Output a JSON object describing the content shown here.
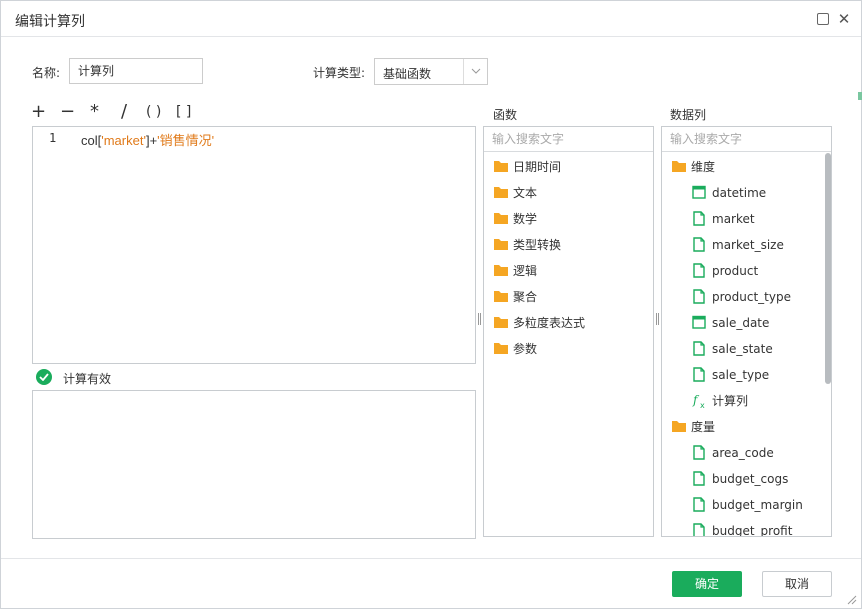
{
  "dialog": {
    "title": "编辑计算列"
  },
  "form": {
    "name_label": "名称:",
    "name_value": "计算列",
    "type_label": "计算类型:",
    "type_value": "基础函数"
  },
  "operators": [
    "+",
    "−",
    "*",
    "/",
    "( )",
    "[ ]"
  ],
  "editor": {
    "line_number": "1",
    "code": {
      "fn": "col",
      "open": "[",
      "arg": "'market'",
      "close": "]",
      "plus": "+",
      "literal": "'销售情况'"
    }
  },
  "validation": {
    "text": "计算有效",
    "color": "#1aac5c"
  },
  "functions_panel": {
    "title": "函数",
    "search_placeholder": "输入搜索文字",
    "items": [
      "日期时间",
      "文本",
      "数学",
      "类型转换",
      "逻辑",
      "聚合",
      "多粒度表达式",
      "参数"
    ]
  },
  "columns_panel": {
    "title": "数据列",
    "search_placeholder": "输入搜索文字",
    "items": [
      {
        "label": "维度",
        "icon": "folder-icon"
      },
      {
        "label": "datetime",
        "icon": "calendar-icon"
      },
      {
        "label": "market",
        "icon": "document-icon"
      },
      {
        "label": "market_size",
        "icon": "document-icon"
      },
      {
        "label": "product",
        "icon": "document-icon"
      },
      {
        "label": "product_type",
        "icon": "document-icon"
      },
      {
        "label": "sale_date",
        "icon": "calendar-icon"
      },
      {
        "label": "sale_state",
        "icon": "document-icon"
      },
      {
        "label": "sale_type",
        "icon": "document-icon"
      },
      {
        "label": "计算列",
        "icon": "function-icon"
      },
      {
        "label": "度量",
        "icon": "folder-icon"
      },
      {
        "label": "area_code",
        "icon": "document-icon"
      },
      {
        "label": "budget_cogs",
        "icon": "document-icon"
      },
      {
        "label": "budget_margin",
        "icon": "document-icon"
      },
      {
        "label": "budget_profit",
        "icon": "document-icon"
      }
    ]
  },
  "footer": {
    "ok_label": "确定",
    "cancel_label": "取消"
  },
  "colors": {
    "accent": "#1aac5c",
    "folder": "#f5a623",
    "string": "#e07a1a"
  }
}
